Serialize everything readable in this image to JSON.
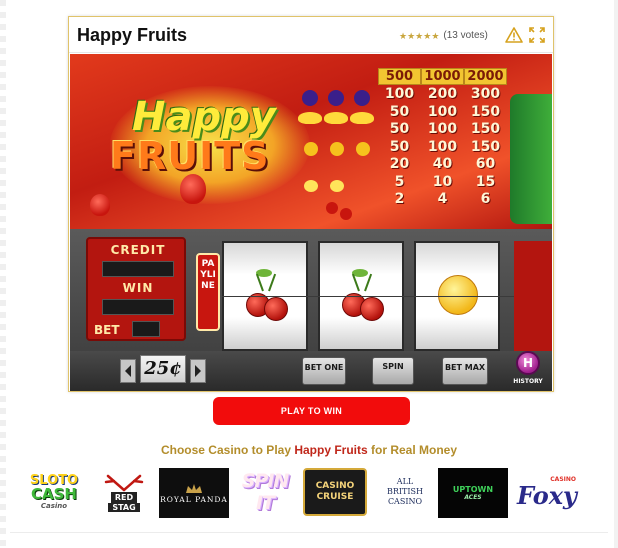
{
  "game": {
    "title": "Happy Fruits",
    "rating_value": 5,
    "rating_max": 5,
    "votes_text": "(13 votes)",
    "icons": [
      "warning-triangle-icon",
      "fullscreen-icon"
    ]
  },
  "slot": {
    "logo_line1": "Happy",
    "logo_line2": "FRUITS",
    "paytable_header": [
      "500",
      "1000",
      "2000"
    ],
    "paytable_rows": [
      [
        "100",
        "200",
        "300"
      ],
      [
        "50",
        "100",
        "150"
      ],
      [
        "50",
        "100",
        "150"
      ],
      [
        "50",
        "100",
        "150"
      ],
      [
        "20",
        "40",
        "60"
      ],
      [
        "5",
        "10",
        "15"
      ],
      [
        "2",
        "4",
        "6"
      ]
    ],
    "credit_label": "CREDIT",
    "win_label": "WIN",
    "bet_label": "BET",
    "payline_label": "PAYLINE",
    "reel_symbols": [
      "cherry-icon",
      "cherry-icon",
      "sun-icon"
    ],
    "coin_value": "25¢",
    "bet_one_label": "BET ONE",
    "spin_label": "SPIN",
    "bet_max_label": "BET MAX",
    "history_glyph": "H",
    "history_label": "HISTORY",
    "colors": {
      "frame_red": "#c21d12",
      "paytable_gold": "#f2c531"
    }
  },
  "cta": {
    "play_label": "PLAY TO WIN",
    "color": "#f20c0c"
  },
  "casinos": {
    "heading_prefix": "Choose Casino to Play ",
    "heading_game": "Happy Fruits",
    "heading_suffix": " for Real Money",
    "logos": [
      {
        "name": "Sloto Cash",
        "line1": "SLOTO",
        "line2": "CASH",
        "line3": "Casino"
      },
      {
        "name": "Red Stag",
        "line1": "RED",
        "line2": "STAG"
      },
      {
        "name": "Royal Panda",
        "line1": "ROYAL PANDA"
      },
      {
        "name": "Spin It",
        "line1": "SPIN IT"
      },
      {
        "name": "Casino Cruise",
        "line1": "CASINO",
        "line2": "CRUISE"
      },
      {
        "name": "All British Casino",
        "line1": "ALL",
        "line2": "BRITISH",
        "line3": "CASINO"
      },
      {
        "name": "Uptown Aces",
        "line1": "UPTOWN",
        "line2": "ACES"
      },
      {
        "name": "Foxy Casino",
        "line1": "Foxy",
        "line2": "CASINO"
      }
    ]
  }
}
